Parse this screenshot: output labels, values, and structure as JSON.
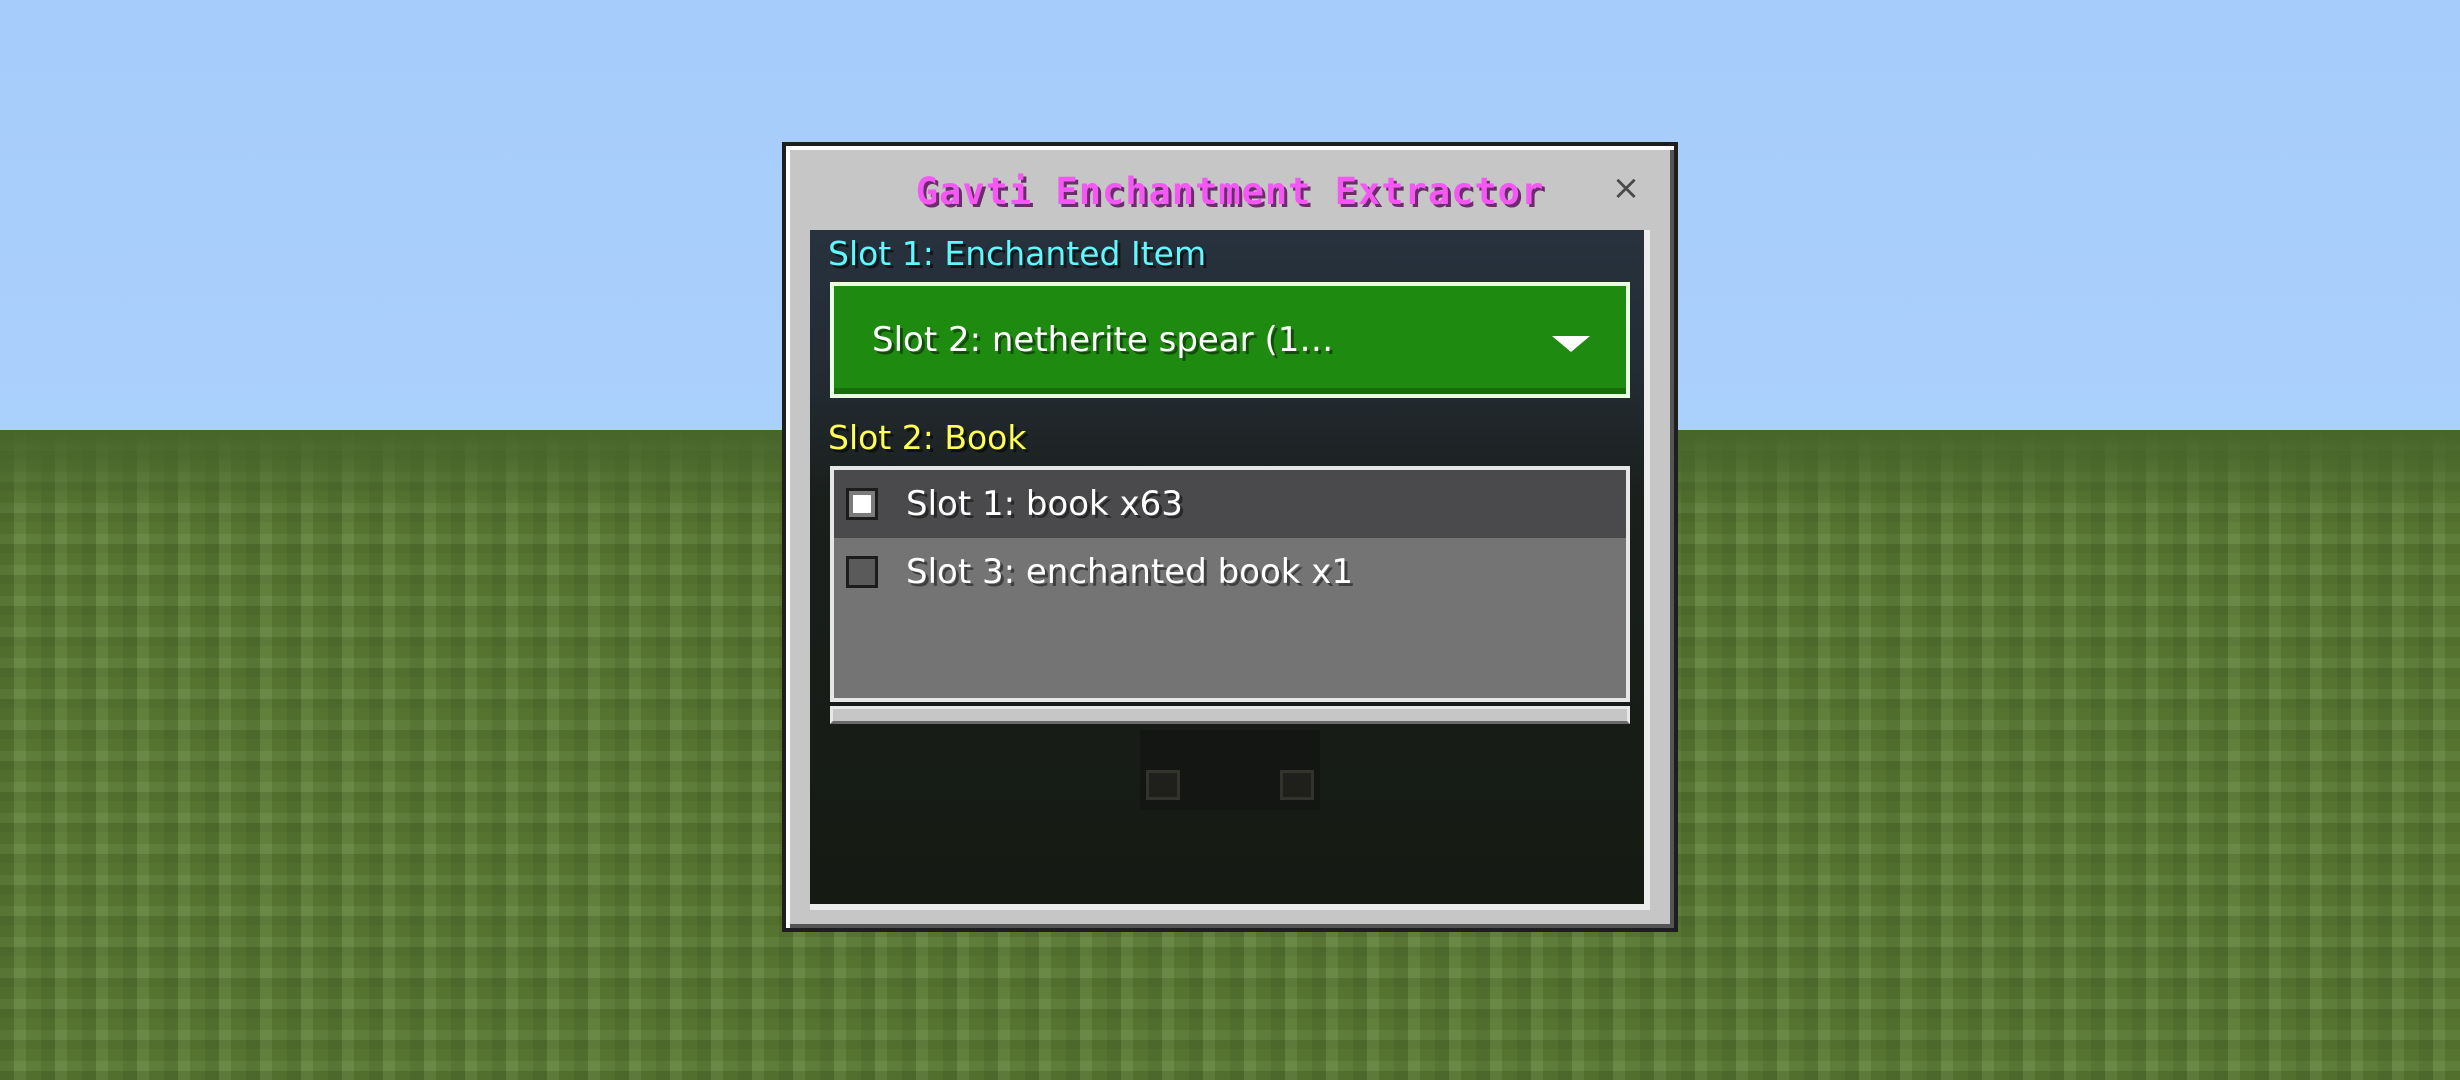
{
  "dialog": {
    "title": "Gavti Enchantment Extractor",
    "close_symbol": "×",
    "close_icon": "close-icon",
    "title_color": "#f557f5"
  },
  "slot1": {
    "label": "Slot 1: Enchanted Item",
    "label_color": "#5ff8ff",
    "dropdown_value": "Slot 2: netherite spear (1…",
    "dropdown_icon": "chevron-down-icon",
    "dropdown_color": "#1f8a10"
  },
  "slot2": {
    "label": "Slot 2: Book",
    "label_color": "#ffff55",
    "options": [
      {
        "label": "Slot 1: book x63",
        "selected": true
      },
      {
        "label": "Slot 3: enchanted book x1",
        "selected": false
      }
    ]
  }
}
